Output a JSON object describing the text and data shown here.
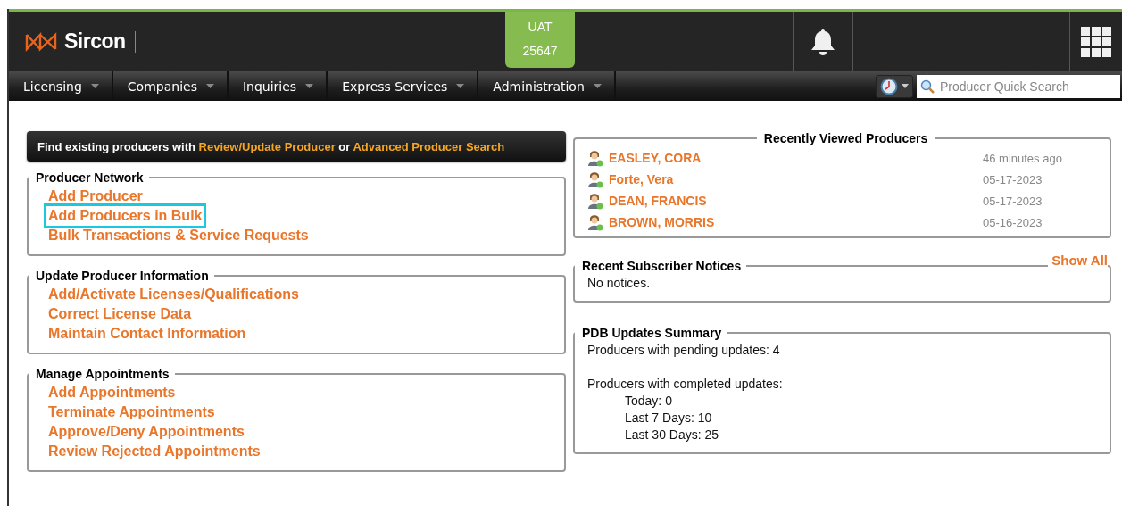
{
  "header": {
    "brand": "Sircon",
    "environment": {
      "name": "UAT",
      "code": "25647"
    }
  },
  "nav": {
    "menus": [
      {
        "label": "Licensing"
      },
      {
        "label": "Companies"
      },
      {
        "label": "Inquiries"
      },
      {
        "label": "Express Services"
      },
      {
        "label": "Administration"
      }
    ],
    "search": {
      "placeholder": "Producer Quick Search"
    }
  },
  "banner": {
    "prefix": "Find existing producers with",
    "link_1": "Review/Update Producer",
    "middle": "or",
    "link_2": "Advanced Producer Search"
  },
  "sections": [
    {
      "title": "Producer Network",
      "links": [
        {
          "label": "Add Producer",
          "highlighted": false
        },
        {
          "label": "Add Producers in Bulk",
          "highlighted": true
        },
        {
          "label": "Bulk Transactions & Service Requests",
          "highlighted": false
        }
      ]
    },
    {
      "title": "Update Producer Information",
      "links": [
        {
          "label": "Add/Activate Licenses/Qualifications",
          "highlighted": false
        },
        {
          "label": "Correct License Data",
          "highlighted": false
        },
        {
          "label": "Maintain Contact Information",
          "highlighted": false
        }
      ]
    },
    {
      "title": "Manage Appointments",
      "links": [
        {
          "label": "Add Appointments",
          "highlighted": false
        },
        {
          "label": "Terminate Appointments",
          "highlighted": false
        },
        {
          "label": "Approve/Deny Appointments",
          "highlighted": false
        },
        {
          "label": "Review Rejected Appointments",
          "highlighted": false
        }
      ]
    }
  ],
  "recently_viewed": {
    "title": "Recently Viewed Producers",
    "producers": [
      {
        "name": "EASLEY, CORA",
        "viewed": "46 minutes ago"
      },
      {
        "name": "Forte, Vera",
        "viewed": "05-17-2023"
      },
      {
        "name": "DEAN, FRANCIS",
        "viewed": "05-17-2023"
      },
      {
        "name": "BROWN, MORRIS",
        "viewed": "05-16-2023"
      }
    ]
  },
  "notices": {
    "show_all": "Show All",
    "title": "Recent Subscriber Notices",
    "text": "No notices."
  },
  "pdb": {
    "title": "PDB Updates Summary",
    "pending": "Producers with pending updates: 4",
    "completed": "Producers with completed updates:",
    "stats": [
      "Today: 0",
      "Last 7 Days: 10",
      "Last 30 Days: 25"
    ]
  }
}
